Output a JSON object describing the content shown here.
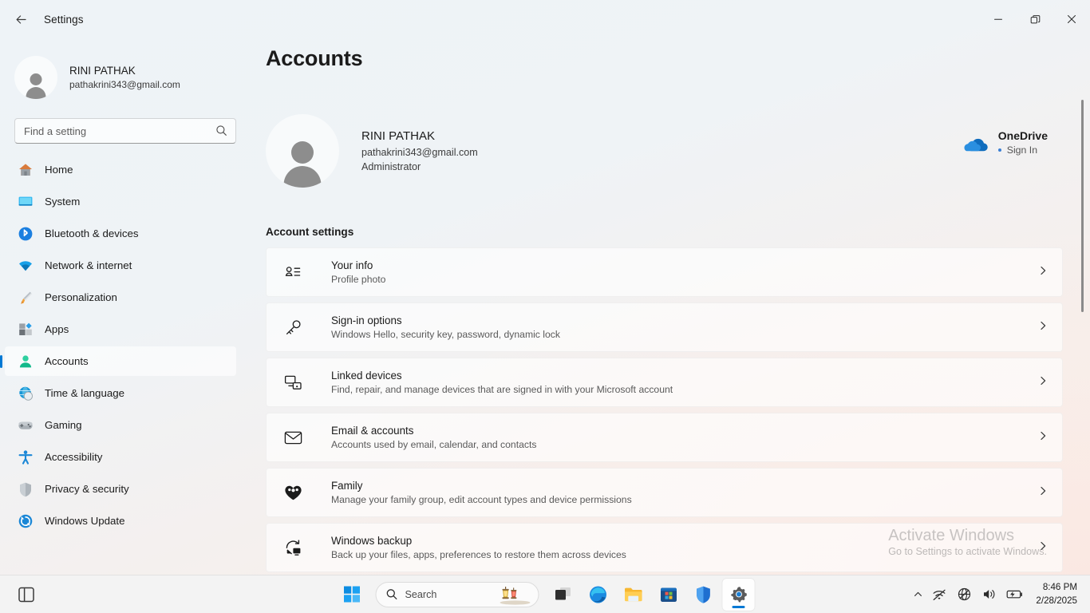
{
  "window": {
    "title": "Settings",
    "back_icon": "back-arrow-icon",
    "controls": {
      "minimize": "minimize-icon",
      "restore": "restore-icon",
      "close": "close-icon"
    }
  },
  "sidebar": {
    "profile": {
      "name": "RINI PATHAK",
      "email": "pathakrini343@gmail.com"
    },
    "search": {
      "placeholder": "Find a setting",
      "value": "",
      "icon": "search-icon"
    },
    "items": [
      {
        "label": "Home",
        "icon": "home-icon",
        "selected": false
      },
      {
        "label": "System",
        "icon": "system-icon",
        "selected": false
      },
      {
        "label": "Bluetooth & devices",
        "icon": "bluetooth-icon",
        "selected": false
      },
      {
        "label": "Network & internet",
        "icon": "network-icon",
        "selected": false
      },
      {
        "label": "Personalization",
        "icon": "brush-icon",
        "selected": false
      },
      {
        "label": "Apps",
        "icon": "apps-icon",
        "selected": false
      },
      {
        "label": "Accounts",
        "icon": "accounts-icon",
        "selected": true
      },
      {
        "label": "Time & language",
        "icon": "clock-globe-icon",
        "selected": false
      },
      {
        "label": "Gaming",
        "icon": "gamepad-icon",
        "selected": false
      },
      {
        "label": "Accessibility",
        "icon": "accessibility-icon",
        "selected": false
      },
      {
        "label": "Privacy & security",
        "icon": "shield-icon",
        "selected": false
      },
      {
        "label": "Windows Update",
        "icon": "update-icon",
        "selected": false
      }
    ]
  },
  "main": {
    "page_title": "Accounts",
    "hero": {
      "name": "RINI PATHAK",
      "email": "pathakrini343@gmail.com",
      "role": "Administrator"
    },
    "onedrive": {
      "title": "OneDrive",
      "status": "Sign In",
      "icon": "onedrive-cloud-icon",
      "dot_color": "#3b7fd4"
    },
    "section_title": "Account settings",
    "cards": [
      {
        "title": "Your info",
        "subtitle": "Profile photo",
        "icon": "contact-card-icon"
      },
      {
        "title": "Sign-in options",
        "subtitle": "Windows Hello, security key, password, dynamic lock",
        "icon": "key-icon"
      },
      {
        "title": "Linked devices",
        "subtitle": "Find, repair, and manage devices that are signed in with your Microsoft account",
        "icon": "devices-icon"
      },
      {
        "title": "Email & accounts",
        "subtitle": "Accounts used by email, calendar, and contacts",
        "icon": "envelope-icon"
      },
      {
        "title": "Family",
        "subtitle": "Manage your family group, edit account types and device permissions",
        "icon": "family-heart-icon"
      },
      {
        "title": "Windows backup",
        "subtitle": "Back up your files, apps, preferences to restore them across devices",
        "icon": "backup-icon"
      }
    ],
    "chevron_icon": "chevron-right-icon"
  },
  "watermark": {
    "title": "Activate Windows",
    "subtitle": "Go to Settings to activate Windows."
  },
  "taskbar": {
    "widgets_icon": "widgets-icon",
    "start_icon": "windows-start-icon",
    "search": {
      "label": "Search",
      "icon": "search-icon"
    },
    "buttons": [
      {
        "name": "task-view",
        "icon": "task-view-icon",
        "active": false,
        "indicator": "none"
      },
      {
        "name": "microsoft-edge",
        "icon": "edge-icon",
        "active": false,
        "indicator": "small"
      },
      {
        "name": "file-explorer",
        "icon": "folder-icon",
        "active": false,
        "indicator": "none"
      },
      {
        "name": "microsoft-store",
        "icon": "store-icon",
        "active": false,
        "indicator": "none"
      },
      {
        "name": "windows-security",
        "icon": "shield-icon",
        "active": false,
        "indicator": "small"
      },
      {
        "name": "settings",
        "icon": "gear-icon",
        "active": true,
        "indicator": "large"
      }
    ],
    "tray": {
      "overflow_icon": "chevron-up-icon",
      "icons": [
        "no-connection-icon",
        "network-blocked-icon",
        "speaker-icon",
        "battery-charging-icon"
      ],
      "time": "8:46 PM",
      "date": "2/28/2025"
    }
  }
}
